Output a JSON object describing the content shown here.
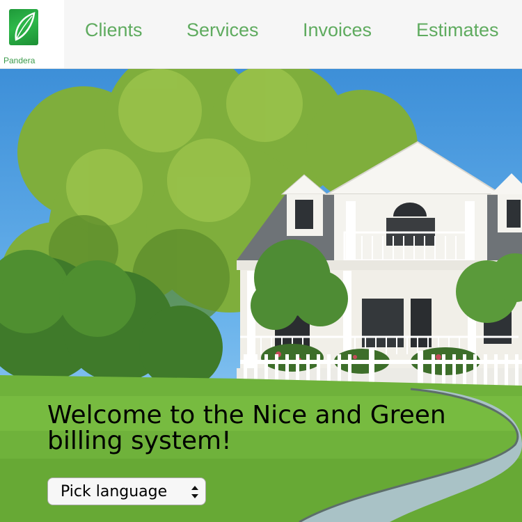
{
  "brand": {
    "name": "Pandera"
  },
  "nav": {
    "items": [
      {
        "label": "Clients"
      },
      {
        "label": "Services"
      },
      {
        "label": "Invoices"
      },
      {
        "label": "Estimates"
      }
    ]
  },
  "hero": {
    "welcome_text": "Welcome to the Nice and Green billing system!",
    "language_select": {
      "selected": "Pick language",
      "icon": "updown-chevron-icon"
    }
  },
  "colors": {
    "nav_text": "#5fab5f",
    "logo_green": "#2eb84a",
    "topbar_bg": "#f6f6f6"
  }
}
